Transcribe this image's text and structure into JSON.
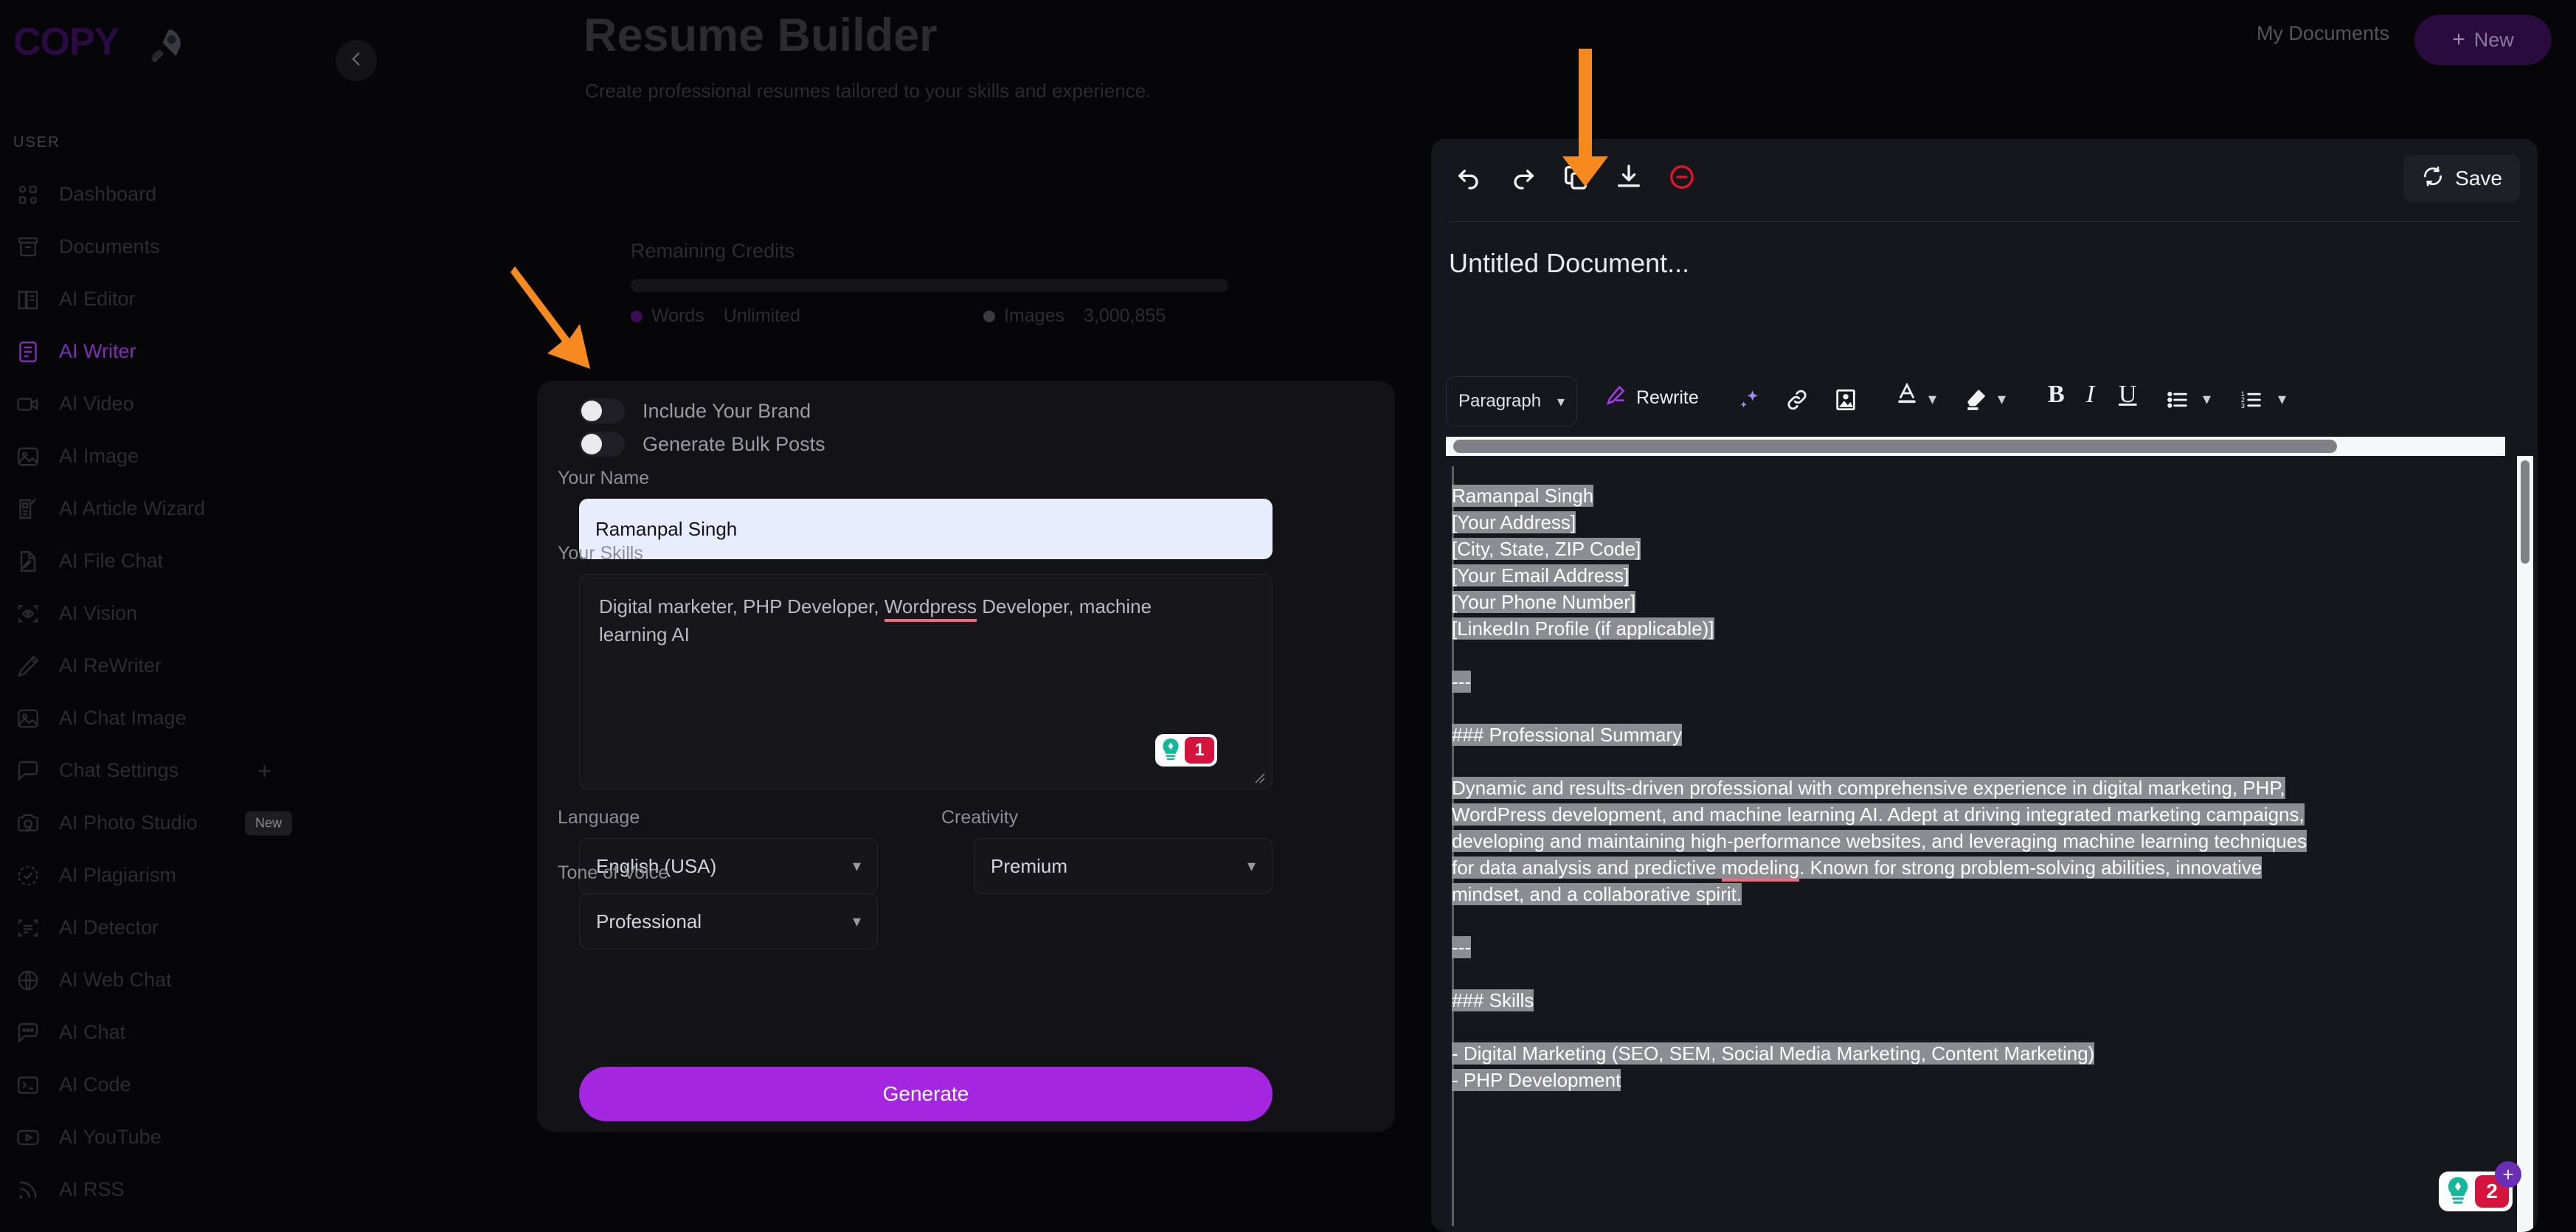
{
  "brand": {
    "logo_text": "COPY",
    "rocket_icon": "rocket-icon"
  },
  "sidebar": {
    "section_label": "USER",
    "items": [
      {
        "label": "Dashboard",
        "icon": "grid-icon",
        "active": false
      },
      {
        "label": "Documents",
        "icon": "archive-icon",
        "active": false
      },
      {
        "label": "AI Editor",
        "icon": "book-open-icon",
        "active": false
      },
      {
        "label": "AI Writer",
        "icon": "document-lines-icon",
        "active": true
      },
      {
        "label": "AI Video",
        "icon": "video-camera-icon",
        "active": false
      },
      {
        "label": "AI Image",
        "icon": "image-icon",
        "active": false
      },
      {
        "label": "AI Article Wizard",
        "icon": "article-wand-icon",
        "active": false
      },
      {
        "label": "AI File Chat",
        "icon": "file-pen-icon",
        "active": false
      },
      {
        "label": "AI Vision",
        "icon": "scan-eye-icon",
        "active": false
      },
      {
        "label": "AI ReWriter",
        "icon": "pencil-icon",
        "active": false
      },
      {
        "label": "AI Chat Image",
        "icon": "image-icon",
        "active": false
      },
      {
        "label": "Chat Settings",
        "icon": "chat-bubble-icon",
        "active": false,
        "trailing": "+"
      },
      {
        "label": "AI Photo Studio",
        "icon": "camera-check-icon",
        "active": false,
        "badge": "New"
      },
      {
        "label": "AI Plagiarism",
        "icon": "circle-check-icon",
        "active": false
      },
      {
        "label": "AI Detector",
        "icon": "scan-text-icon",
        "active": false
      },
      {
        "label": "AI Web Chat",
        "icon": "globe-www-icon",
        "active": false
      },
      {
        "label": "AI Chat",
        "icon": "chat-dots-icon",
        "active": false
      },
      {
        "label": "AI Code",
        "icon": "terminal-icon",
        "active": false
      },
      {
        "label": "AI YouTube",
        "icon": "youtube-icon",
        "active": false
      },
      {
        "label": "AI RSS",
        "icon": "rss-icon",
        "active": false
      }
    ]
  },
  "header": {
    "title": "Resume Builder",
    "subtitle": "Create professional resumes tailored to your skills and experience.",
    "my_documents": "My Documents",
    "new_button": "New",
    "new_plus": "+",
    "collapse_icon": "chevron-left-icon"
  },
  "credits": {
    "title": "Remaining Credits",
    "words_label": "Words",
    "words_value": "Unlimited",
    "words_dot_color": "#3b0d55",
    "images_label": "Images",
    "images_value": "3,000,855",
    "images_dot_color": "#3a3a42",
    "bar_fill_percent": 0
  },
  "form": {
    "toggle_brand": "Include Your Brand",
    "toggle_bulk": "Generate Bulk Posts",
    "name_label": "Your Name",
    "name_value": "Ramanpal Singh",
    "skills_label": "Your Skills",
    "skills_text_a": "Digital marketer, PHP Developer, ",
    "skills_misspelled": "Wordpress",
    "skills_text_b": " Developer, machine learning AI",
    "grammarly_count": "1",
    "language_label": "Language",
    "language_value": "English (USA)",
    "creativity_label": "Creativity",
    "creativity_value": "Premium",
    "tone_label": "Tone of Voice",
    "tone_value": "Professional",
    "generate_button": "Generate",
    "accent_color": "#a526e0"
  },
  "editor": {
    "tools": [
      {
        "name": "undo-icon",
        "label": "Undo"
      },
      {
        "name": "redo-icon",
        "label": "Redo"
      },
      {
        "name": "copy-icon",
        "label": "Copy"
      },
      {
        "name": "download-icon",
        "label": "Download"
      },
      {
        "name": "delete-circle-icon",
        "label": "Delete"
      }
    ],
    "save_label": "Save",
    "doc_title": "Untitled Document...",
    "paragraph_value": "Paragraph",
    "rewrite_label": "Rewrite",
    "format_icons": [
      "sparkle-icon",
      "link-icon",
      "image-insert-icon",
      "text-color-icon",
      "highlighter-icon",
      "bold-icon",
      "italic-icon",
      "underline-icon",
      "bullet-list-icon",
      "numbered-list-icon"
    ],
    "grammarly_count": "2",
    "grammarly_plus": "+",
    "content": {
      "lines": [
        "Ramanpal Singh",
        "[Your Address]",
        "[City, State, ZIP Code]",
        "[Your Email Address]",
        "[Your Phone Number]",
        "[LinkedIn Profile (if applicable)]"
      ],
      "rule1": "---",
      "heading1": "### Professional Summary",
      "summary_a": "Dynamic and results-driven professional with comprehensive experience in digital marketing, PHP, WordPress development, and machine learning AI. Adept at driving integrated marketing campaigns, developing and maintaining high-performance websites, and leveraging machine learning techniques for data analysis and predictive ",
      "summary_misspelled": "modeling",
      "summary_b": ". Known for strong problem-solving abilities, innovative mindset, and a collaborative spirit.",
      "rule2": "---",
      "heading2": "### Skills",
      "skill1": "- Digital Marketing (SEO, SEM, Social Media Marketing, Content Marketing)",
      "skill2": "- PHP Development"
    }
  },
  "annotations": [
    {
      "name": "arrow-to-form-card",
      "color": "#f68a1e"
    },
    {
      "name": "arrow-to-copy-icon",
      "color": "#f68a1e"
    }
  ]
}
